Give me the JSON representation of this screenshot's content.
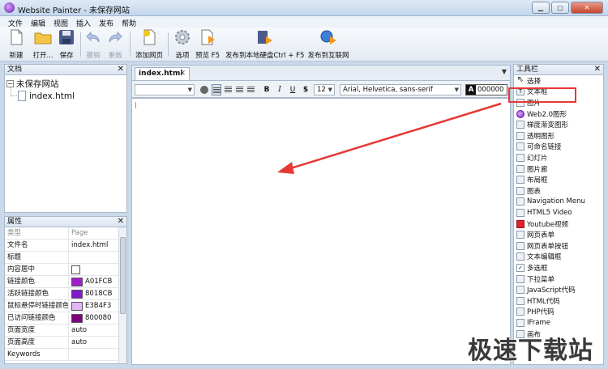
{
  "window": {
    "title": "Website Painter - 未保存网站",
    "min": "▁",
    "max": "▢",
    "close": "✕"
  },
  "menu": [
    "文件",
    "编辑",
    "视图",
    "插入",
    "发布",
    "帮助"
  ],
  "toolbar": [
    {
      "label": "新建",
      "icon": "new-file-icon",
      "enabled": true
    },
    {
      "label": "打开...",
      "icon": "open-folder-icon",
      "enabled": true
    },
    {
      "label": "保存",
      "icon": "save-icon",
      "enabled": true
    },
    {
      "label": "撤销",
      "icon": "undo-icon",
      "enabled": false
    },
    {
      "label": "重做",
      "icon": "redo-icon",
      "enabled": false
    },
    {
      "label": "添加网页",
      "icon": "add-page-icon",
      "enabled": true
    },
    {
      "label": "选项",
      "icon": "gear-icon",
      "enabled": true
    },
    {
      "label": "预览 F5",
      "icon": "preview-icon",
      "enabled": true
    },
    {
      "label": "发布到本地硬盘Ctrl + F5",
      "icon": "publish-disk-icon",
      "enabled": true
    },
    {
      "label": "发布到互联网",
      "icon": "publish-web-icon",
      "enabled": true
    }
  ],
  "docs": {
    "title": "文档",
    "close": "✕",
    "root": "未保存网站",
    "root_toggle": "−",
    "child": "index.html"
  },
  "props": {
    "title": "属性",
    "close": "✕",
    "rows": [
      {
        "key": "类型",
        "value": "Page",
        "muted": true
      },
      {
        "key": "文件名",
        "value": "index.html"
      },
      {
        "key": "标题",
        "value": ""
      },
      {
        "key": "内容居中",
        "value": "",
        "checkbox": true
      },
      {
        "key": "链接颜色",
        "value": "A01FCB",
        "color": "#A01FCB"
      },
      {
        "key": "活跃链接颜色",
        "value": "8018CB",
        "color": "#8018CB"
      },
      {
        "key": "鼠标悬停时链接颜色",
        "value": "E3B4F3",
        "color": "#E3B4F3"
      },
      {
        "key": "已访问链接颜色",
        "value": "800080",
        "color": "#800080"
      },
      {
        "key": "页面宽度",
        "value": "auto"
      },
      {
        "key": "页面高度",
        "value": "auto"
      },
      {
        "key": "Keywords",
        "value": ""
      }
    ]
  },
  "editor": {
    "tab": "index.html",
    "tab_close": "✕",
    "tab_menu": "▼",
    "font_size": "12",
    "font_family": "Arial, Helvetica, sans-serif",
    "color_label": "A",
    "color_value": "000000",
    "bold": "B",
    "italic": "I",
    "underline": "U",
    "link": "$"
  },
  "tools": {
    "title": "工具栏",
    "close": "✕",
    "items": [
      {
        "label": "选择",
        "icon": "cursor-icon"
      },
      {
        "label": "文本框",
        "icon": "textbox-icon"
      },
      {
        "label": "图片",
        "icon": "image-icon"
      },
      {
        "label": "Web2.0图形",
        "icon": "web2-shape-icon"
      },
      {
        "label": "梯度渐变图形",
        "icon": "gradient-shape-icon"
      },
      {
        "label": "透明图形",
        "icon": "transparent-shape-icon"
      },
      {
        "label": "可命名链接",
        "icon": "anchor-link-icon"
      },
      {
        "label": "幻灯片",
        "icon": "slideshow-icon"
      },
      {
        "label": "图片廊",
        "icon": "gallery-icon"
      },
      {
        "label": "布局框",
        "icon": "layout-box-icon"
      },
      {
        "label": "图表",
        "icon": "table-icon"
      },
      {
        "label": "Navigation Menu",
        "icon": "nav-menu-icon"
      },
      {
        "label": "HTML5 Video",
        "icon": "video-icon"
      },
      {
        "label": "Youtube视频",
        "icon": "youtube-icon"
      },
      {
        "label": "网页表单",
        "icon": "form-icon"
      },
      {
        "label": "网页表单按钮",
        "icon": "form-button-icon"
      },
      {
        "label": "文本编辑框",
        "icon": "text-edit-icon"
      },
      {
        "label": "多选框",
        "icon": "checkbox-icon"
      },
      {
        "label": "下拉菜单",
        "icon": "dropdown-icon"
      },
      {
        "label": "JavaScript代码",
        "icon": "javascript-icon"
      },
      {
        "label": "HTML代码",
        "icon": "html-icon"
      },
      {
        "label": "PHP代码",
        "icon": "php-icon"
      },
      {
        "label": "IFrame",
        "icon": "iframe-icon"
      },
      {
        "label": "画布",
        "icon": "canvas-icon"
      }
    ]
  },
  "watermark": "极速下载站"
}
